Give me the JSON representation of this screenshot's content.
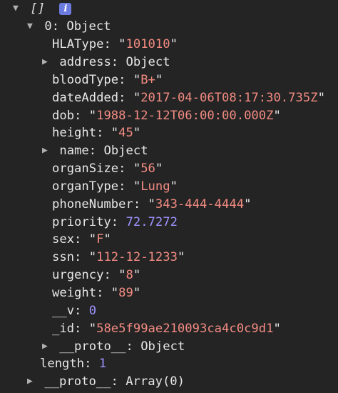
{
  "root": {
    "label": "[]",
    "info_symbol": "i"
  },
  "item": {
    "key": "0",
    "type": "Object",
    "fields": {
      "HLAType": {
        "key": "HLAType",
        "value": "101010"
      },
      "address": {
        "key": "address",
        "value": "Object"
      },
      "bloodType": {
        "key": "bloodType",
        "value": "B+"
      },
      "dateAdded": {
        "key": "dateAdded",
        "value": "2017-04-06T08:17:30.735Z"
      },
      "dob": {
        "key": "dob",
        "value": "1988-12-12T06:00:00.000Z"
      },
      "height": {
        "key": "height",
        "value": "45"
      },
      "name": {
        "key": "name",
        "value": "Object"
      },
      "organSize": {
        "key": "organSize",
        "value": "56"
      },
      "organType": {
        "key": "organType",
        "value": "Lung"
      },
      "phoneNumber": {
        "key": "phoneNumber",
        "value": "343-444-4444"
      },
      "priority": {
        "key": "priority",
        "value": "72.7272"
      },
      "sex": {
        "key": "sex",
        "value": "F"
      },
      "ssn": {
        "key": "ssn",
        "value": "112-12-1233"
      },
      "urgency": {
        "key": "urgency",
        "value": "8"
      },
      "weight": {
        "key": "weight",
        "value": "89"
      },
      "v": {
        "key": "__v",
        "value": "0"
      },
      "id": {
        "key": "_id",
        "value": "58e5f99ae210093ca4c0c9d1"
      },
      "proto": {
        "key": "__proto__",
        "value": "Object"
      }
    }
  },
  "length": {
    "key": "length",
    "value": "1"
  },
  "array_proto": {
    "key": "__proto__",
    "value": "Array(0)"
  }
}
